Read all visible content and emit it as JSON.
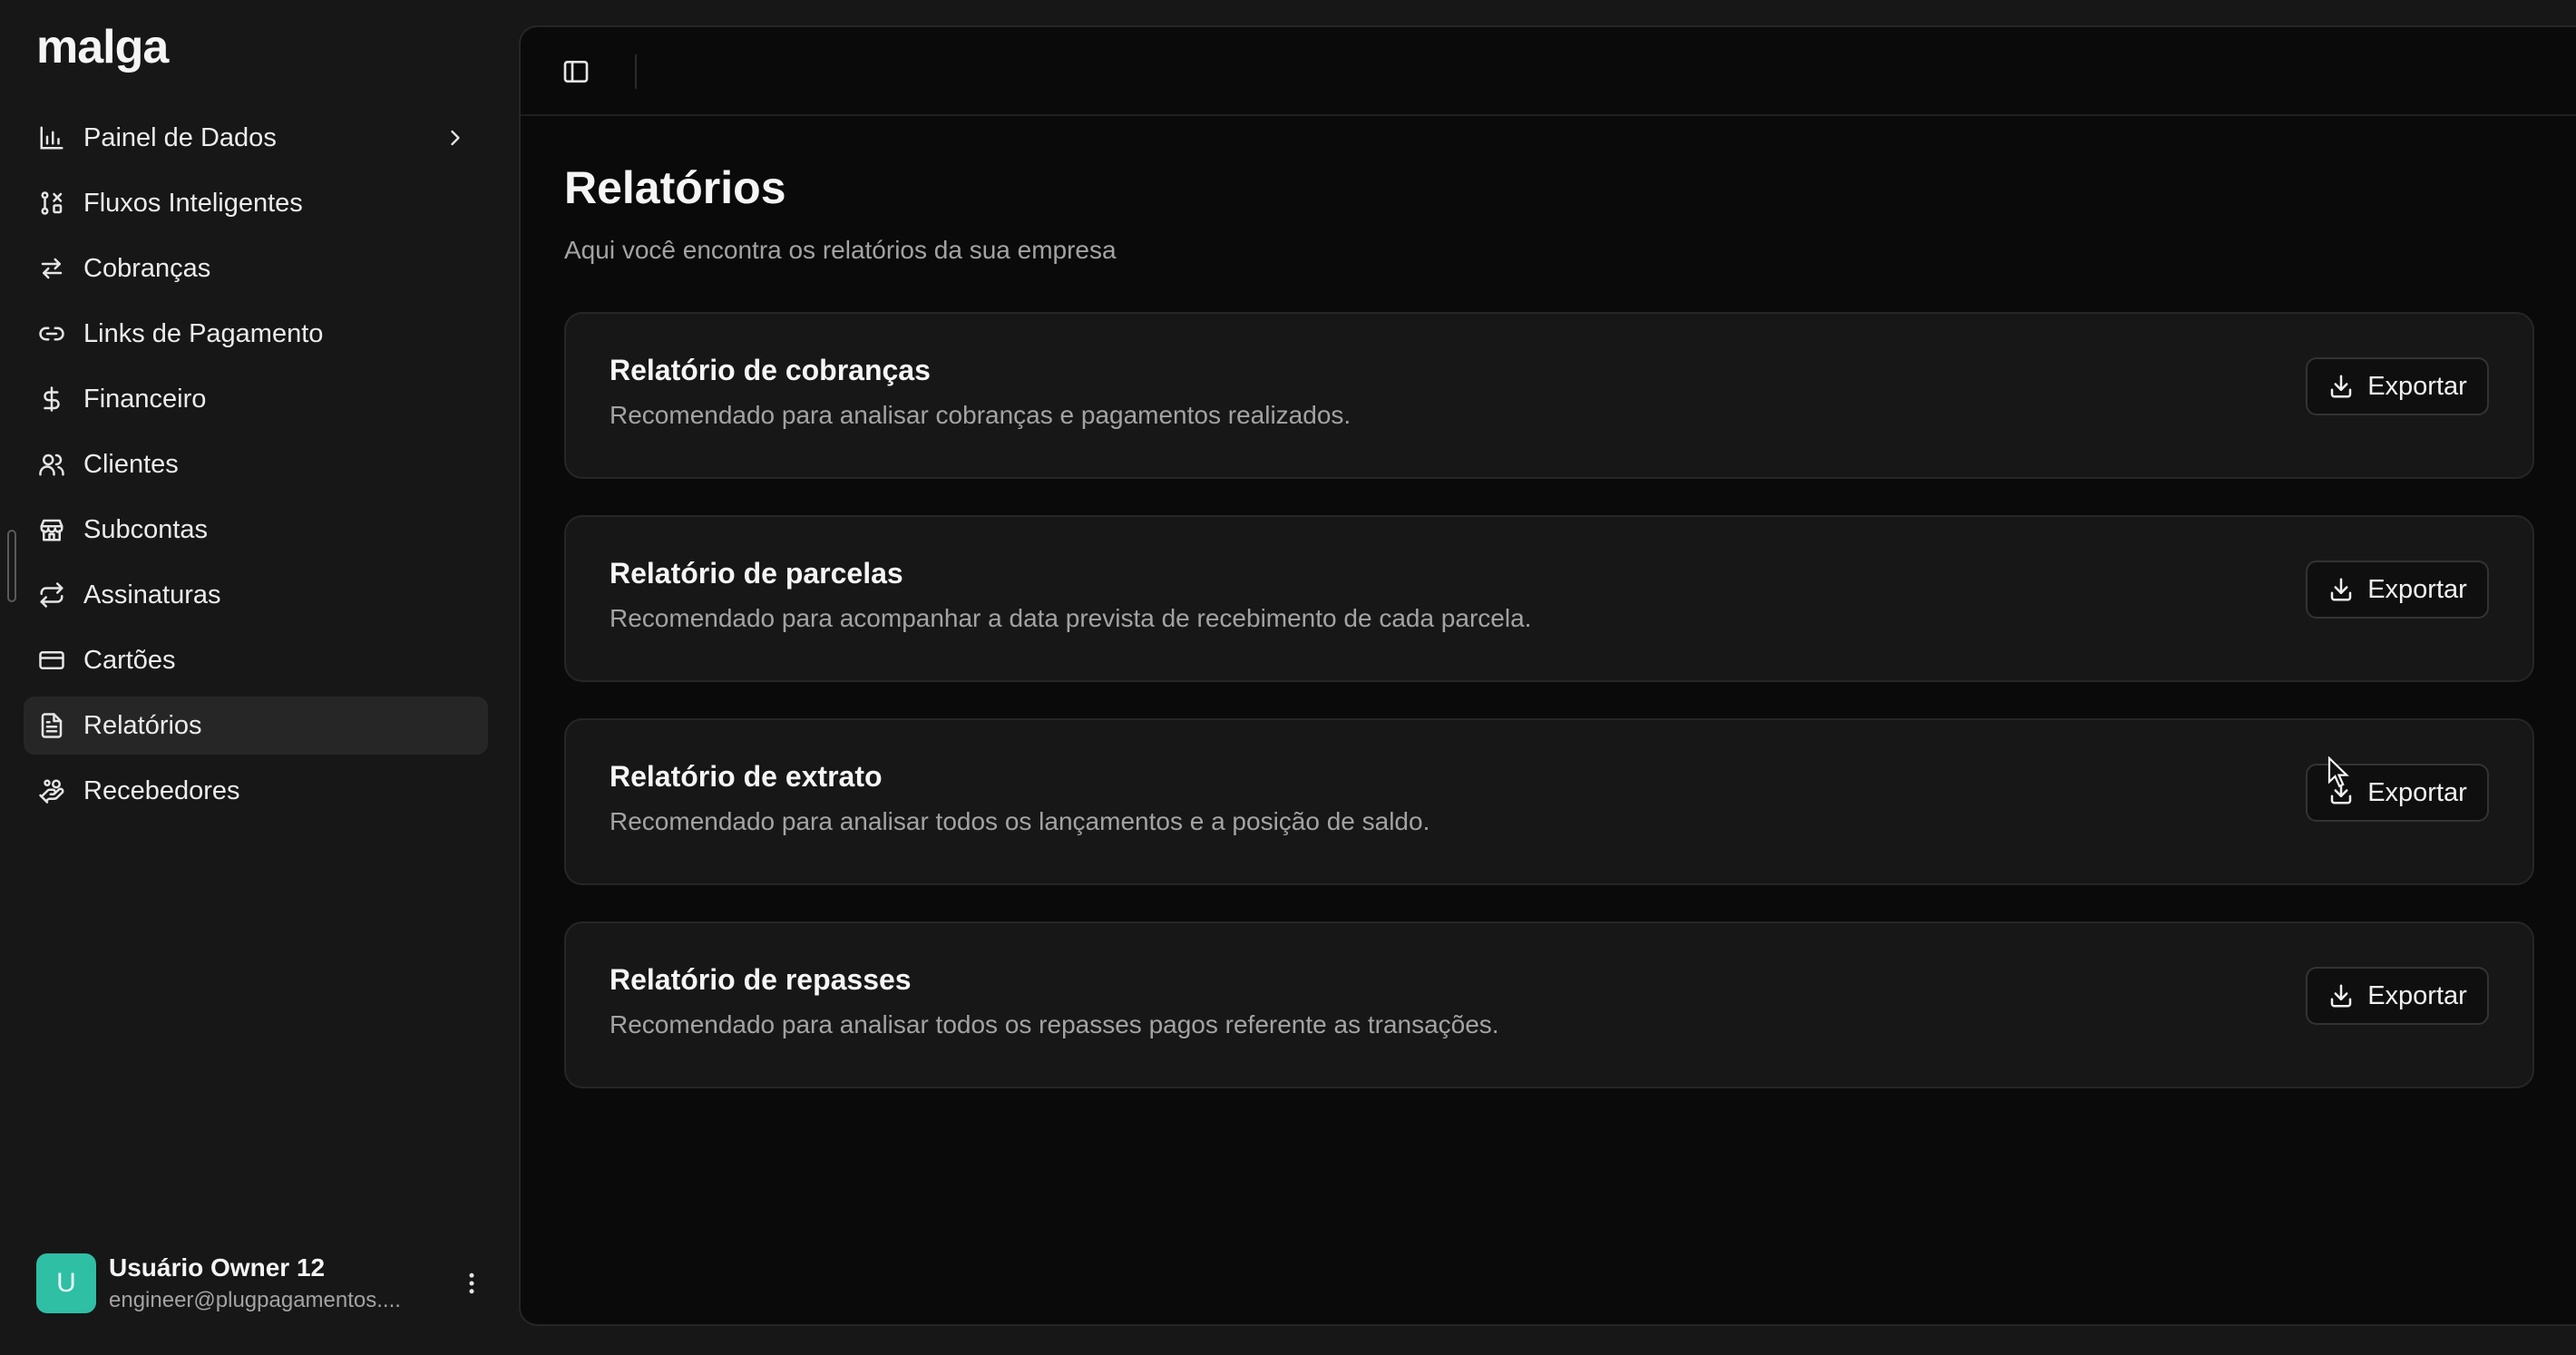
{
  "brand": {
    "logo": "malga"
  },
  "sidebar": {
    "items": [
      {
        "label": "Painel de Dados",
        "icon": "bar-chart-icon",
        "active": false
      },
      {
        "label": "Fluxos Inteligentes",
        "icon": "workflow-icon",
        "active": false
      },
      {
        "label": "Cobranças",
        "icon": "arrows-exchange-icon",
        "active": false
      },
      {
        "label": "Links de Pagamento",
        "icon": "link-icon",
        "active": false
      },
      {
        "label": "Financeiro",
        "icon": "dollar-icon",
        "active": false
      },
      {
        "label": "Clientes",
        "icon": "users-icon",
        "active": false
      },
      {
        "label": "Subcontas",
        "icon": "store-icon",
        "active": false
      },
      {
        "label": "Assinaturas",
        "icon": "repeat-icon",
        "active": false
      },
      {
        "label": "Cartões",
        "icon": "credit-card-icon",
        "active": false
      },
      {
        "label": "Relatórios",
        "icon": "file-report-icon",
        "active": true
      },
      {
        "label": "Recebedores",
        "icon": "hand-coins-icon",
        "active": false
      }
    ]
  },
  "user": {
    "initial": "U",
    "name": "Usuário Owner 12",
    "email": "engineer@plugpagamentos....",
    "avatar_color": "#2ebfa5"
  },
  "page": {
    "title": "Relatórios",
    "subtitle": "Aqui você encontra os relatórios da sua empresa"
  },
  "reports": [
    {
      "title": "Relatório de cobranças",
      "description": "Recomendado para analisar cobranças e pagamentos realizados.",
      "button": "Exportar"
    },
    {
      "title": "Relatório de parcelas",
      "description": "Recomendado para acompanhar a data prevista de recebimento de cada parcela.",
      "button": "Exportar"
    },
    {
      "title": "Relatório de extrato",
      "description": "Recomendado para analisar todos os lançamentos e a posição de saldo.",
      "button": "Exportar"
    },
    {
      "title": "Relatório de repasses",
      "description": "Recomendado para analisar todos os repasses pagos referente as transações.",
      "button": "Exportar"
    }
  ],
  "colors": {
    "background": "#171717",
    "panel": "#0a0a0a",
    "card": "#171717",
    "active_item": "#262626"
  }
}
